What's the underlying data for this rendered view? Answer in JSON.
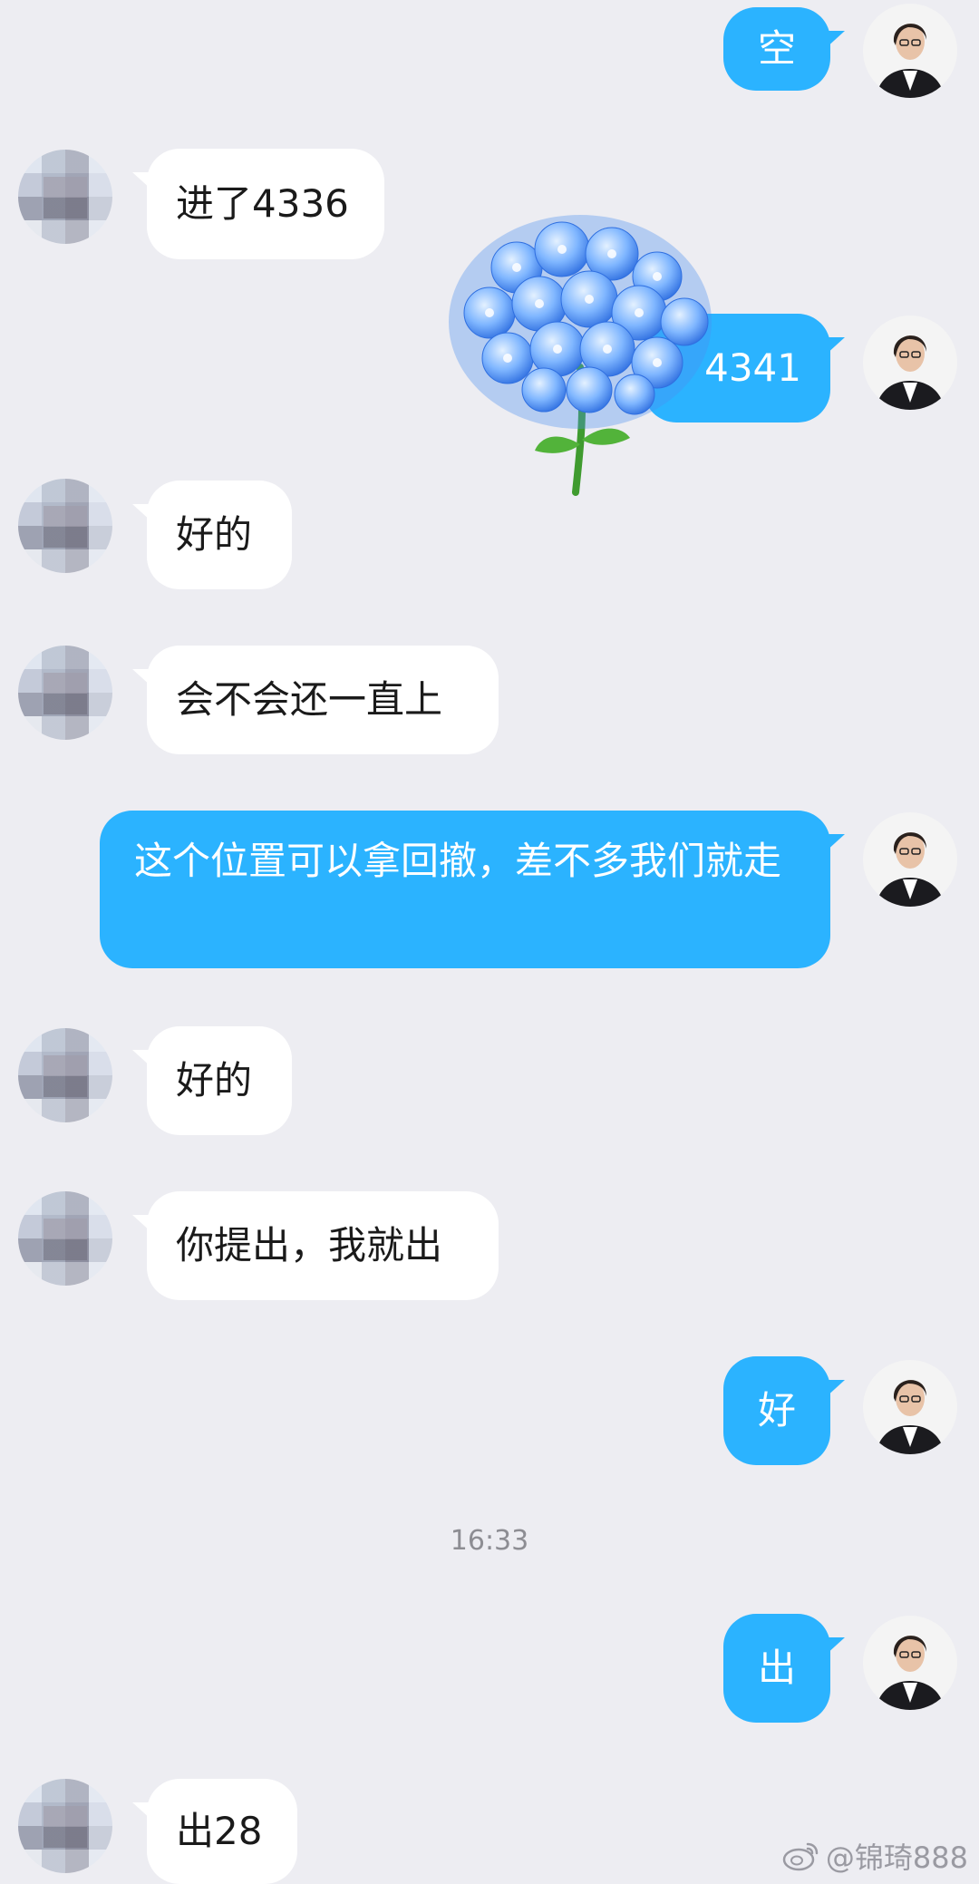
{
  "messages": [
    {
      "side": "out",
      "text": "空"
    },
    {
      "side": "in",
      "text": "进了4336"
    },
    {
      "side": "out",
      "text": "4341"
    },
    {
      "side": "in",
      "text": "好的"
    },
    {
      "side": "in",
      "text": "会不会还一直上"
    },
    {
      "side": "out",
      "text": "这个位置可以拿回撤，差不多我们就走"
    },
    {
      "side": "in",
      "text": "好的"
    },
    {
      "side": "in",
      "text": "你提出，我就出"
    },
    {
      "side": "out",
      "text": "好"
    },
    {
      "side": "out",
      "text": "出"
    },
    {
      "side": "in",
      "text": "出28"
    }
  ],
  "timestamp": "16:33",
  "watermark": "@锦琦888",
  "colors": {
    "background": "#ededf2",
    "outgoing_bubble": "#2bb3ff",
    "incoming_bubble": "#ffffff"
  },
  "icons": {
    "sticker": "blue-hydrangea-sticker",
    "watermark_logo": "weibo-logo-icon"
  }
}
